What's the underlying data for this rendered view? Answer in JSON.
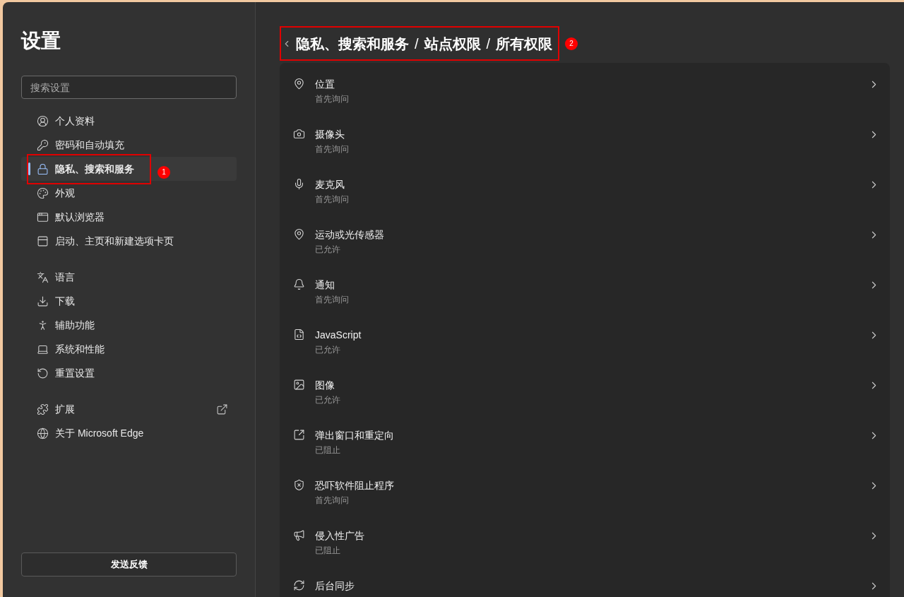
{
  "sidebar": {
    "title": "设置",
    "search": {
      "placeholder": "搜索设置"
    },
    "groups": [
      [
        {
          "label": "个人资料",
          "selected": false,
          "kind": "page"
        },
        {
          "label": "密码和自动填充",
          "selected": false,
          "kind": "page"
        },
        {
          "label": "隐私、搜索和服务",
          "selected": true,
          "kind": "page",
          "annotation": "1"
        },
        {
          "label": "外观",
          "selected": false,
          "kind": "page"
        },
        {
          "label": "默认浏览器",
          "selected": false,
          "kind": "page"
        },
        {
          "label": "启动、主页和新建选项卡页",
          "selected": false,
          "kind": "page"
        }
      ],
      [
        {
          "label": "语言",
          "selected": false,
          "kind": "page"
        },
        {
          "label": "下载",
          "selected": false,
          "kind": "page"
        },
        {
          "label": "辅助功能",
          "selected": false,
          "kind": "page"
        },
        {
          "label": "系统和性能",
          "selected": false,
          "kind": "page"
        },
        {
          "label": "重置设置",
          "selected": false,
          "kind": "page"
        }
      ],
      [
        {
          "label": "扩展",
          "selected": false,
          "kind": "external"
        },
        {
          "label": "关于 Microsoft Edge",
          "selected": false,
          "kind": "page"
        }
      ]
    ],
    "feedback_button": "发送反馈"
  },
  "header": {
    "breadcrumb": [
      {
        "kind": "segment",
        "text": "隐私、搜索和服务"
      },
      {
        "kind": "separator",
        "text": "/"
      },
      {
        "kind": "segment",
        "text": "站点权限"
      },
      {
        "kind": "separator",
        "text": "/"
      },
      {
        "kind": "segment",
        "text": "所有权限"
      }
    ],
    "annotation": "2"
  },
  "permissions": [
    {
      "title": "位置",
      "status": "首先询问"
    },
    {
      "title": "摄像头",
      "status": "首先询问"
    },
    {
      "title": "麦克风",
      "status": "首先询问"
    },
    {
      "title": "运动或光传感器",
      "status": "已允许"
    },
    {
      "title": "通知",
      "status": "首先询问"
    },
    {
      "title": "JavaScript",
      "status": "已允许"
    },
    {
      "title": "图像",
      "status": "已允许"
    },
    {
      "title": "弹出窗口和重定向",
      "status": "已阻止"
    },
    {
      "title": "恐吓软件阻止程序",
      "status": "首先询问"
    },
    {
      "title": "侵入性广告",
      "status": "已阻止"
    },
    {
      "title": "后台同步"
    }
  ]
}
